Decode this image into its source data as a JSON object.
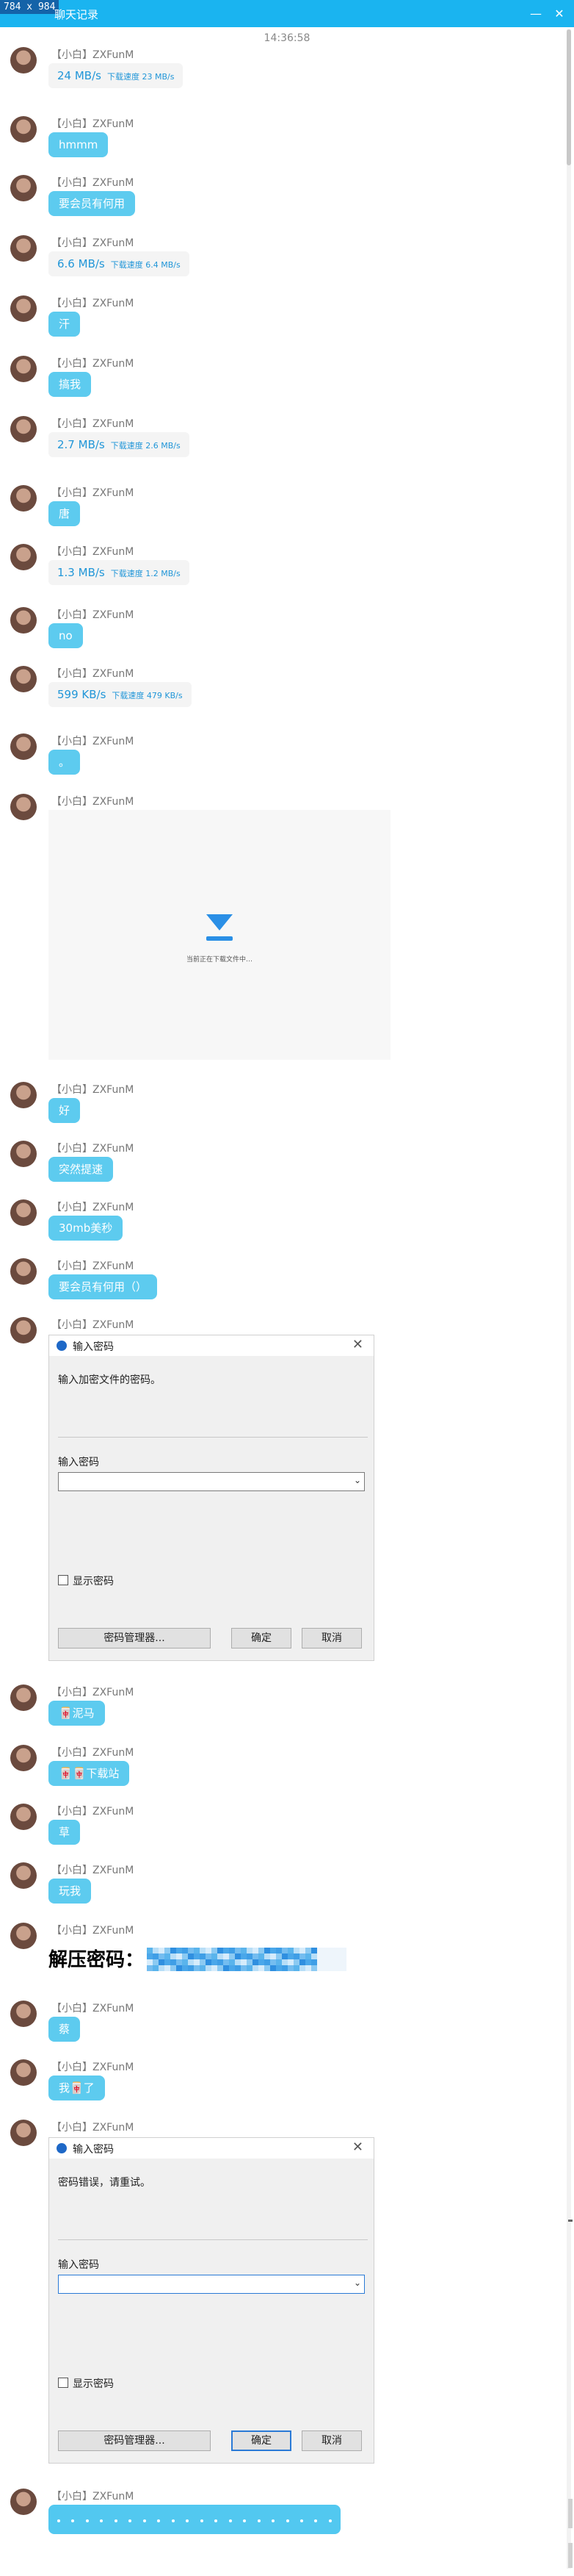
{
  "window": {
    "dimension_label": "784 x 984",
    "title": "聊天记录",
    "timestamp": "14:36:58"
  },
  "sender_name": "【小白】ZXFunM",
  "messages": [
    {
      "kind": "speed",
      "speed": "24 MB/s",
      "detail": "下载速度 23 MB/s"
    },
    {
      "kind": "text",
      "text": "hmmm"
    },
    {
      "kind": "text",
      "text": "要会员有何用"
    },
    {
      "kind": "speed",
      "speed": "6.6 MB/s",
      "detail": "下载速度 6.4 MB/s"
    },
    {
      "kind": "text",
      "text": "汗"
    },
    {
      "kind": "text",
      "text": "搞我"
    },
    {
      "kind": "speed",
      "speed": "2.7 MB/s",
      "detail": "下载速度 2.6 MB/s"
    },
    {
      "kind": "text",
      "text": "唐"
    },
    {
      "kind": "speed",
      "speed": "1.3 MB/s",
      "detail": "下载速度 1.2 MB/s"
    },
    {
      "kind": "text",
      "text": "no"
    },
    {
      "kind": "speed",
      "speed": "599 KB/s",
      "detail": "下载速度 479 KB/s"
    },
    {
      "kind": "text",
      "text": "。"
    },
    {
      "kind": "image",
      "caption": "当前正在下载文件中…"
    },
    {
      "kind": "text",
      "text": "好"
    },
    {
      "kind": "text",
      "text": "突然提速"
    },
    {
      "kind": "text",
      "text": "30mb美秒"
    },
    {
      "kind": "text",
      "text": "要会员有何用（）"
    },
    {
      "kind": "dialog",
      "dialog": "first"
    },
    {
      "kind": "text",
      "text": "🀄泥马"
    },
    {
      "kind": "text",
      "text": "🀄🀄下载站"
    },
    {
      "kind": "text",
      "text": "草"
    },
    {
      "kind": "text",
      "text": "玩我"
    },
    {
      "kind": "password",
      "label": "解压密码："
    },
    {
      "kind": "text",
      "text": "蔡"
    },
    {
      "kind": "text",
      "text": "我🀄了"
    },
    {
      "kind": "dialog",
      "dialog": "second"
    },
    {
      "kind": "dots"
    }
  ],
  "dialogs": {
    "first": {
      "title": "输入密码",
      "prompt": "输入加密文件的密码。",
      "field_label": "输入密码",
      "show_password": "显示密码",
      "manager_button": "密码管理器...",
      "ok_button": "确定",
      "cancel_button": "取消",
      "close_glyph": "✕"
    },
    "second": {
      "title": "输入密码",
      "prompt": "密码错误，请重试。",
      "field_label": "输入密码",
      "show_password": "显示密码",
      "manager_button": "密码管理器...",
      "ok_button": "确定",
      "cancel_button": "取消",
      "close_glyph": "✕"
    }
  },
  "icons": {
    "minimize": "—",
    "close": "✕",
    "dropdown": "⌄"
  },
  "colors": {
    "titlebar": "#1ab4f0",
    "bubble": "#5dcbef",
    "speed_text": "#2196d8",
    "download_arrow": "#2a8fe6"
  }
}
